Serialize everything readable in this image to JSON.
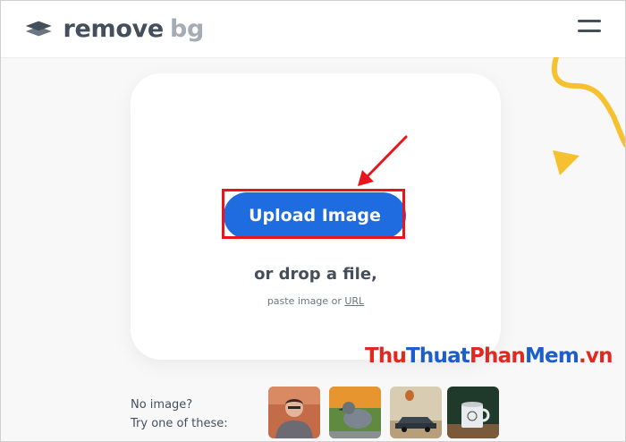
{
  "header": {
    "logo_word_remove": "remove",
    "logo_word_bg": "bg",
    "menu_icon": "hamburger-menu-icon"
  },
  "upload": {
    "button_label": "Upload Image",
    "drop_text": "or drop a file,",
    "paste_text": "paste image or",
    "url_link": "URL"
  },
  "samples": {
    "line1": "No image?",
    "line2": "Try one of these:",
    "thumbnails": [
      "person-photo",
      "pigeon-photo",
      "car-photo",
      "mug-photo"
    ]
  },
  "watermark": {
    "part_red_1": "Thu",
    "part_blue_1": "Thuat",
    "part_red_2": "Phan",
    "part_blue_2": "Mem",
    "part_red_3": ".vn"
  },
  "colors": {
    "accent_blue": "#1f6ce0",
    "highlight_red": "#e8151d",
    "deco_yellow": "#f6c131",
    "text_dark": "#454f5b",
    "text_muted": "#a5acb4"
  }
}
